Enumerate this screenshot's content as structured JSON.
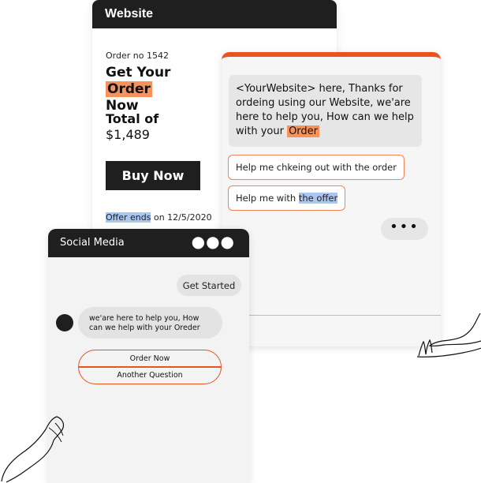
{
  "website": {
    "title": "Website",
    "order_no": "Order no 1542",
    "headline_prefix": "Get Your",
    "headline_highlight": "Order",
    "headline_suffix": "Now",
    "total_label": "Total of",
    "total_value": "$1,489",
    "buy_label": "Buy Now",
    "offer_highlight": "Offer ends",
    "offer_rest": " on 12/5/2020"
  },
  "chat": {
    "message_text": "<YourWebsite> here, Thanks for ordeing using our Website, we'are here to help you, How can we help with your ",
    "message_highlight": "Order",
    "option1": "Help me chkeing out with the order",
    "option2_prefix": "Help me with ",
    "option2_highlight": "the offer",
    "typing": "•••"
  },
  "social": {
    "title": "Social Media",
    "menu_dots": "●●●",
    "get_started": "Get Started",
    "bot_message": "we'are here to help you, How can we help with your Oreder",
    "quick_replies": [
      "Order Now",
      "Another Question"
    ]
  },
  "colors": {
    "accent_orange": "#e8541e",
    "highlight_orange": "#f6935c",
    "highlight_blue": "#a9c7f0",
    "dark": "#1f1f1f"
  },
  "icons": [
    "more-menu-icon",
    "avatar-dot",
    "typing-indicator-icon",
    "hand-illustration"
  ]
}
